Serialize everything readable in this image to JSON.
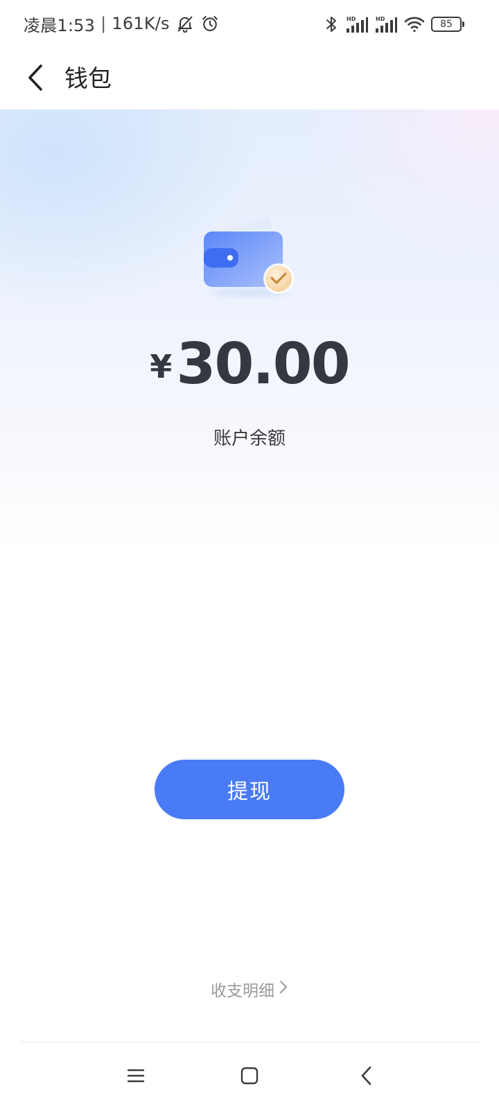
{
  "status_bar": {
    "time": "凌晨1:53",
    "separator": "|",
    "net_speed": "161K/s",
    "icons_left": [
      "mute-bell-icon",
      "alarm-icon"
    ],
    "icons_right": [
      "bluetooth-icon",
      "signal-hd-icon",
      "signal-hd-icon",
      "wifi-icon",
      "battery-icon"
    ],
    "battery_level": "85"
  },
  "header": {
    "title": "钱包",
    "back_icon": "chevron-left-icon"
  },
  "wallet": {
    "icon": "wallet-check-icon",
    "currency_symbol": "¥",
    "balance": "30.00",
    "balance_label": "账户余额"
  },
  "actions": {
    "withdraw_label": "提现",
    "detail_label": "收支明细"
  },
  "nav_bar": {
    "buttons": [
      "menu-icon",
      "home-icon",
      "back-icon"
    ]
  },
  "colors": {
    "primary": "#4a7bf6",
    "text_dark": "#35383e",
    "text_muted": "#9a9a9a"
  }
}
